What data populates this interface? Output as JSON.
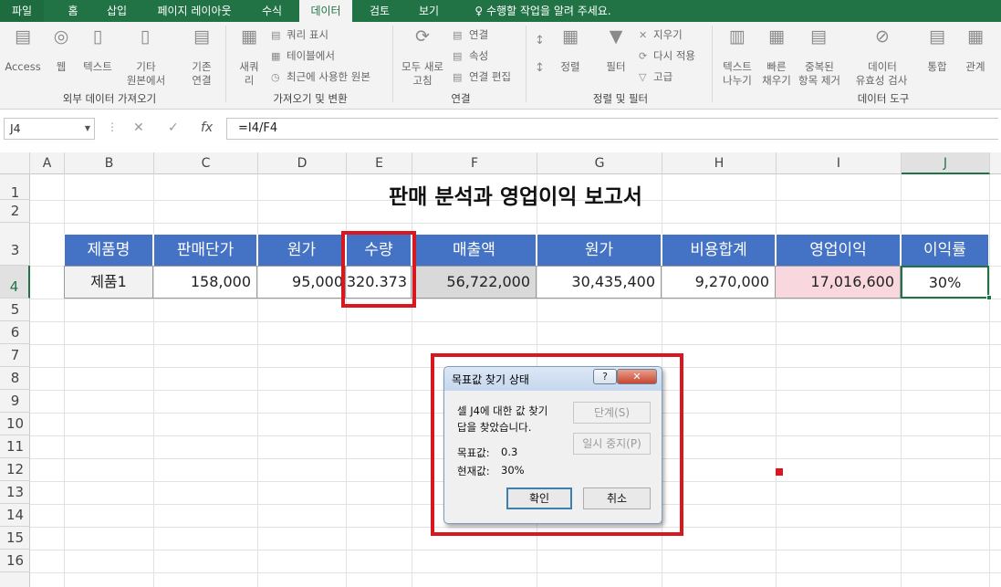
{
  "tabs": [
    "파일",
    "홈",
    "삽입",
    "페이지 레이아웃",
    "수식",
    "데이터",
    "검토",
    "보기",
    "수행할 작업을 알려 주세요."
  ],
  "ribbon": {
    "external": {
      "items": [
        "Access",
        "웹",
        "텍스트",
        "기타",
        "원본에서",
        "기존",
        "연결"
      ],
      "group": "외부 데이터 가져오기"
    },
    "gettransform": {
      "new_query": [
        "새쿼",
        "리"
      ],
      "small": [
        "쿼리 표시",
        "테이블에서",
        "최근에 사용한 원본"
      ],
      "group": "가져오기 및 변환"
    },
    "connections": {
      "refresh": [
        "모두 새로",
        "고침"
      ],
      "small": [
        "연결",
        "속성",
        "연결 편집"
      ],
      "group": "연결"
    },
    "sortfilter": {
      "sort": "정렬",
      "filter": "필터",
      "small": [
        "지우기",
        "다시 적용",
        "고급"
      ],
      "group": "정렬 및 필터"
    },
    "datatools": {
      "items": [
        "텍스트",
        "나누기",
        "빠른",
        "채우기",
        "중복된",
        "항목 제거",
        "데이터",
        "유효성 검사",
        "통합",
        "관계"
      ],
      "group": "데이터 도구"
    }
  },
  "namebox": "J4",
  "formula": "=I4/F4",
  "columns": [
    "A",
    "B",
    "C",
    "D",
    "E",
    "F",
    "G",
    "H",
    "I",
    "J"
  ],
  "rows": [
    "1",
    "2",
    "3",
    "4",
    "5",
    "6",
    "7",
    "8",
    "9",
    "10",
    "11",
    "12",
    "13",
    "14",
    "15",
    "16"
  ],
  "sheet": {
    "title": "판매 분석과 영업이익 보고서",
    "headers": [
      "제품명",
      "판매단가",
      "원가",
      "수량",
      "매출액",
      "원가",
      "비용합계",
      "영업이익",
      "이익률"
    ],
    "row4": [
      "제품1",
      "158,000",
      "95,000",
      "320.373",
      "56,722,000",
      "30,435,400",
      "9,270,000",
      "17,016,600",
      "30%"
    ]
  },
  "dialog": {
    "title": "목표값 찾기 상태",
    "help": "?",
    "close": "✕",
    "message1": "셀 J4에 대한 값 찾기",
    "message2": "답을 찾았습니다.",
    "target_label": "목표값:",
    "target_value": "0.3",
    "current_label": "현재값:",
    "current_value": "30%",
    "step_button": "단계(S)",
    "pause_button": "일시 중지(P)",
    "ok_button": "확인",
    "cancel_button": "취소"
  },
  "colors": {
    "header_fill": "#4472c4",
    "green": "#217346",
    "highlight_gray": "#d9d9d9",
    "highlight_pink": "#f8d7df",
    "annotation_red": "#d9171f"
  }
}
